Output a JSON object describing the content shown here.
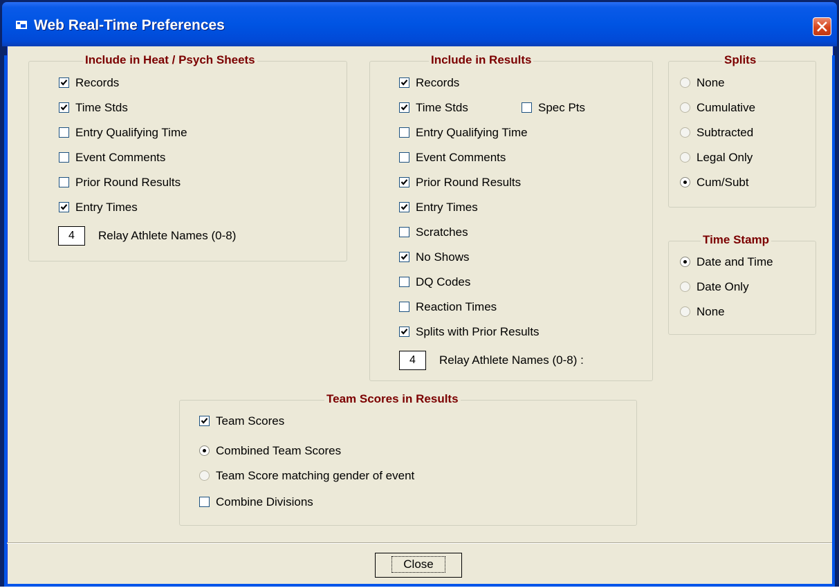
{
  "window": {
    "title": "Web Real-Time Preferences"
  },
  "heat_psych": {
    "title": "Include in Heat / Psych Sheets",
    "items": [
      {
        "label": "Records",
        "checked": true
      },
      {
        "label": "Time Stds",
        "checked": true
      },
      {
        "label": "Entry Qualifying Time",
        "checked": false
      },
      {
        "label": "Event Comments",
        "checked": false
      },
      {
        "label": "Prior Round Results",
        "checked": false
      },
      {
        "label": "Entry Times",
        "checked": true
      }
    ],
    "relay_value": "4",
    "relay_label": "Relay Athlete Names (0-8)"
  },
  "results": {
    "title": "Include in Results",
    "items": [
      {
        "label": "Records",
        "checked": true
      },
      {
        "label": "Time Stds",
        "checked": true
      },
      {
        "label": "Entry Qualifying Time",
        "checked": false
      },
      {
        "label": "Event Comments",
        "checked": false
      },
      {
        "label": "Prior Round Results",
        "checked": true
      },
      {
        "label": "Entry Times",
        "checked": true
      },
      {
        "label": "Scratches",
        "checked": false
      },
      {
        "label": "No Shows",
        "checked": true
      },
      {
        "label": "DQ Codes",
        "checked": false
      },
      {
        "label": "Reaction Times",
        "checked": false
      },
      {
        "label": "Splits with Prior Results",
        "checked": true
      }
    ],
    "spec_pts": {
      "label": "Spec Pts",
      "checked": false
    },
    "relay_value": "4",
    "relay_label": "Relay Athlete Names (0-8) :"
  },
  "splits": {
    "title": "Splits",
    "options": [
      {
        "label": "None",
        "selected": false
      },
      {
        "label": "Cumulative",
        "selected": false
      },
      {
        "label": "Subtracted",
        "selected": false
      },
      {
        "label": "Legal Only",
        "selected": false
      },
      {
        "label": "Cum/Subt",
        "selected": true
      }
    ]
  },
  "time_stamp": {
    "title": "Time Stamp",
    "options": [
      {
        "label": "Date and Time",
        "selected": true
      },
      {
        "label": "Date Only",
        "selected": false
      },
      {
        "label": "None",
        "selected": false
      }
    ]
  },
  "team_scores": {
    "title": "Team Scores in Results",
    "team_scores": {
      "label": "Team Scores",
      "checked": true
    },
    "options": [
      {
        "label": "Combined Team Scores",
        "selected": true
      },
      {
        "label": "Team Score matching gender of event",
        "selected": false
      }
    ],
    "combine_divisions": {
      "label": "Combine Divisions",
      "checked": false
    }
  },
  "close_label": "Close"
}
